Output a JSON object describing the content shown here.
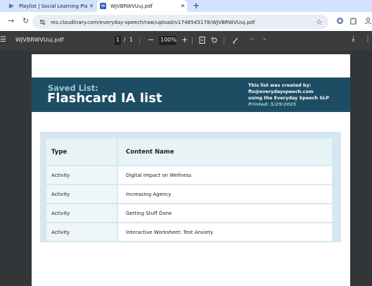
{
  "browser": {
    "tabs": [
      {
        "title": "Playlist | Social Learning Platfor",
        "icon": "social-learning-favicon",
        "active": false
      },
      {
        "title": "WJVBRWVUuj.pdf",
        "icon": "pdf-favicon",
        "active": true
      }
    ],
    "address": {
      "url": "res.cloudinary.com/everyday-speech/raw/upload/v1748545178/WJVBRWVUuj.pdf"
    }
  },
  "pdf_viewer": {
    "filename": "WJVBRWVUuj.pdf",
    "current_page": "1",
    "page_separator": "/",
    "total_pages": "1",
    "zoom": "100%"
  },
  "document": {
    "kicker": "Saved List:",
    "list_title": "Flashcard IA list",
    "created_by_label": "This list was created by:",
    "creator_email": "flo@everydayspeech.com",
    "creator_role": "using the Everyday Speech SLP",
    "printed": "Printed: 5/29/2025",
    "table": {
      "headers": [
        "Type",
        "Content Name"
      ],
      "rows": [
        [
          "Activity",
          "Digital Impact on Wellness"
        ],
        [
          "Activity",
          "Increasing Agency"
        ],
        [
          "Activity",
          "Getting Stuff Done"
        ],
        [
          "Activity",
          "Interactive Worksheet: Test Anxiety"
        ]
      ]
    }
  },
  "colors": {
    "banner": "#1e4d63",
    "kicker": "#9cc6d6",
    "table_panel": "#d5e8f1",
    "viewer_background": "#333639"
  }
}
